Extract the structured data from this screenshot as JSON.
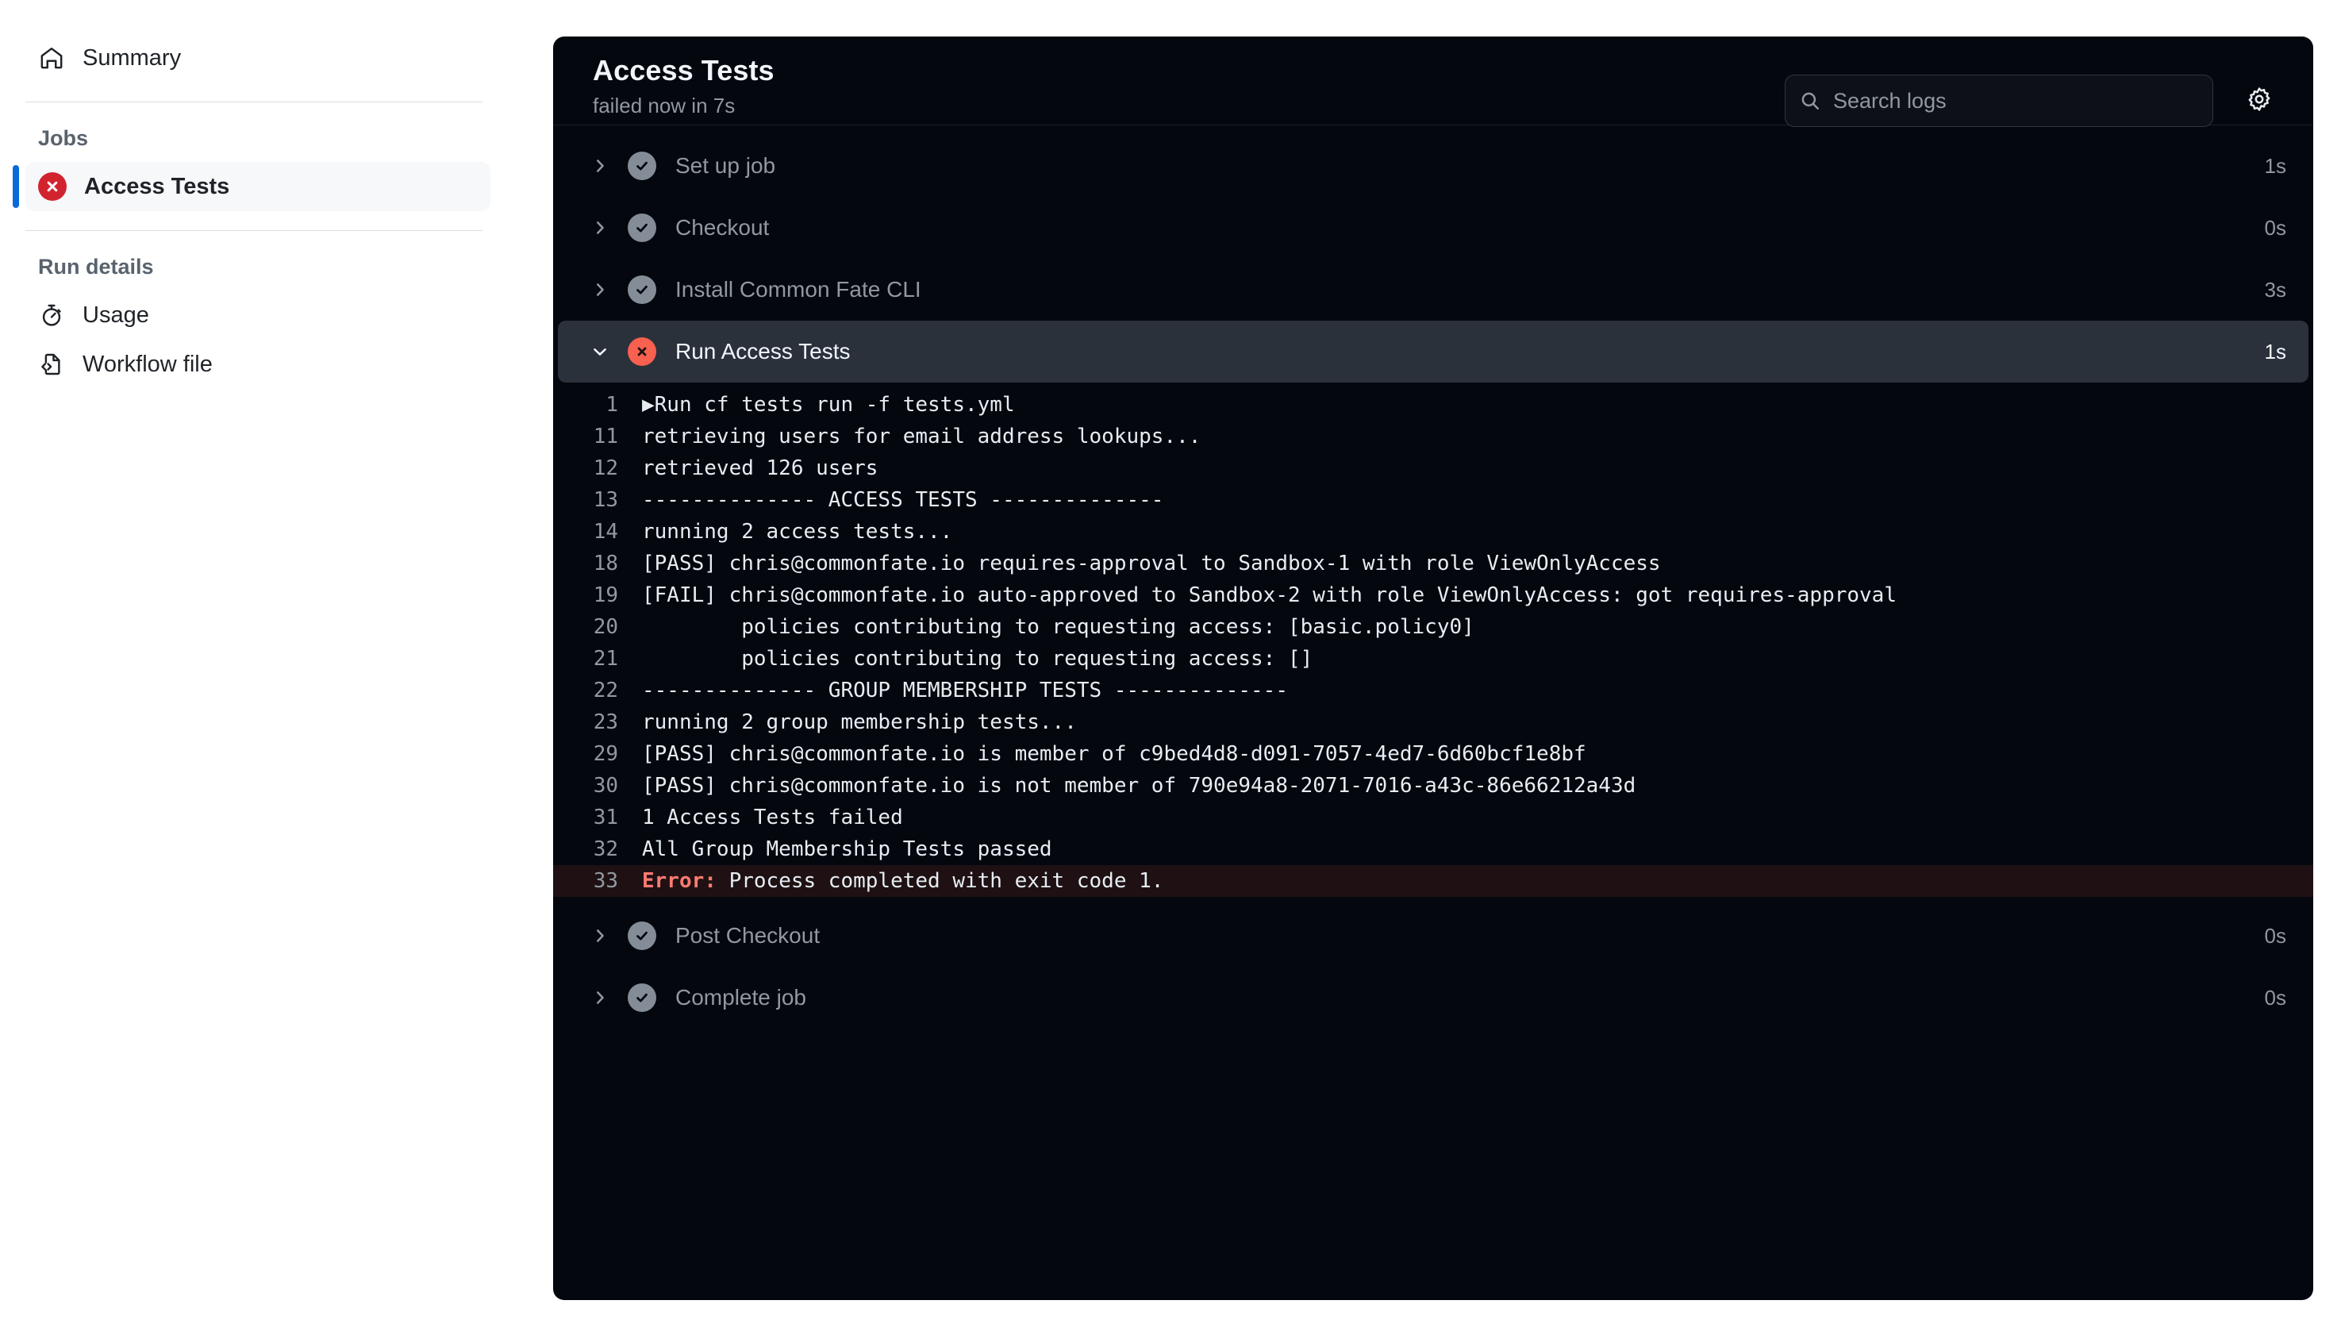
{
  "sidebar": {
    "summary": {
      "label": "Summary",
      "icon": "home-icon"
    },
    "jobs_heading": "Jobs",
    "job": {
      "label": "Access Tests",
      "status": "failed",
      "icon": "x-circle-icon"
    },
    "run_details_heading": "Run details",
    "usage": {
      "label": "Usage",
      "icon": "stopwatch-icon"
    },
    "workflow_file": {
      "label": "Workflow file",
      "icon": "file-code-icon"
    }
  },
  "header": {
    "title": "Access Tests",
    "subtitle": "failed now in 7s",
    "search_placeholder": "Search logs",
    "search_value": "",
    "search_icon": "search-icon",
    "settings_icon": "gear-icon"
  },
  "steps": [
    {
      "label": "Set up job",
      "status": "success",
      "duration": "1s",
      "expanded": false,
      "selected": false
    },
    {
      "label": "Checkout",
      "status": "success",
      "duration": "0s",
      "expanded": false,
      "selected": false
    },
    {
      "label": "Install Common Fate CLI",
      "status": "success",
      "duration": "3s",
      "expanded": false,
      "selected": false
    },
    {
      "label": "Run Access Tests",
      "status": "failure",
      "duration": "1s",
      "expanded": true,
      "selected": true
    },
    {
      "label": "Post Checkout",
      "status": "success",
      "duration": "0s",
      "expanded": false,
      "selected": false
    },
    {
      "label": "Complete job",
      "status": "success",
      "duration": "0s",
      "expanded": false,
      "selected": false
    }
  ],
  "log": {
    "lines": [
      {
        "n": "1",
        "text": "▶Run cf tests run -f tests.yml",
        "kind": "group"
      },
      {
        "n": "11",
        "text": "retrieving users for email address lookups...",
        "kind": "plain"
      },
      {
        "n": "12",
        "text": "retrieved 126 users",
        "kind": "plain"
      },
      {
        "n": "13",
        "text": "-------------- ACCESS TESTS --------------",
        "kind": "plain"
      },
      {
        "n": "14",
        "text": "running 2 access tests...",
        "kind": "plain"
      },
      {
        "n": "18",
        "text": "[PASS] chris@commonfate.io requires-approval to Sandbox-1 with role ViewOnlyAccess",
        "kind": "plain"
      },
      {
        "n": "19",
        "text": "[FAIL] chris@commonfate.io auto-approved to Sandbox-2 with role ViewOnlyAccess: got requires-approval",
        "kind": "plain"
      },
      {
        "n": "20",
        "text": "        policies contributing to requesting access: [basic.policy0]",
        "kind": "plain"
      },
      {
        "n": "21",
        "text": "        policies contributing to requesting access: []",
        "kind": "plain"
      },
      {
        "n": "22",
        "text": "-------------- GROUP MEMBERSHIP TESTS --------------",
        "kind": "plain"
      },
      {
        "n": "23",
        "text": "running 2 group membership tests...",
        "kind": "plain"
      },
      {
        "n": "29",
        "text": "[PASS] chris@commonfate.io is member of c9bed4d8-d091-7057-4ed7-6d60bcf1e8bf",
        "kind": "plain"
      },
      {
        "n": "30",
        "text": "[PASS] chris@commonfate.io is not member of 790e94a8-2071-7016-a43c-86e66212a43d",
        "kind": "plain"
      },
      {
        "n": "31",
        "text": "1 Access Tests failed",
        "kind": "plain"
      },
      {
        "n": "32",
        "text": "All Group Membership Tests passed",
        "kind": "plain"
      },
      {
        "n": "33",
        "text": "Process completed with exit code 1.",
        "kind": "error",
        "prefix": "Error:"
      }
    ]
  },
  "colors": {
    "panel_bg": "#04070e",
    "selected_step_bg": "#2b313b",
    "error_line_bg": "#1f1113",
    "error_text": "#ff7b72",
    "fail_badge": "#f8604f",
    "sidebar_fail_badge": "#d1242f",
    "accent_blue": "#0969da",
    "muted_text": "#9198a1"
  }
}
